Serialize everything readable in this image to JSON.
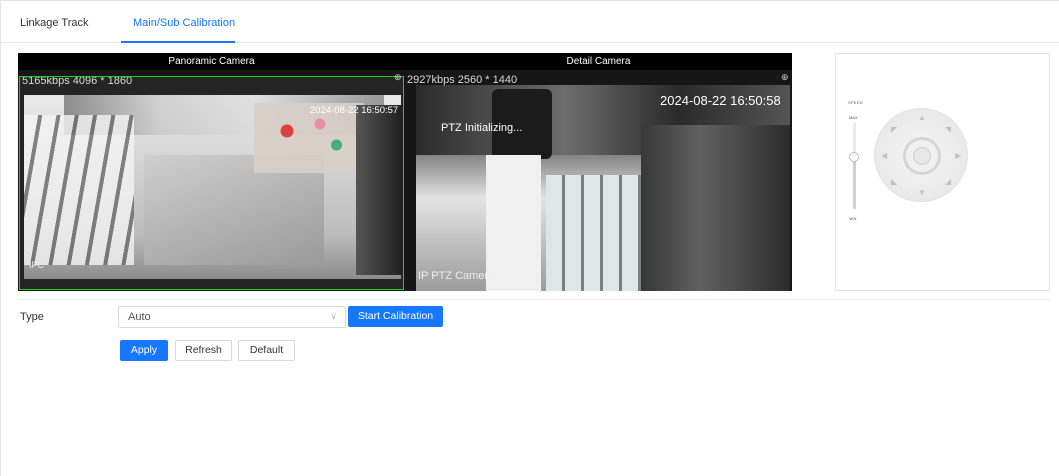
{
  "tabs": [
    {
      "label": "Linkage Track",
      "active": false
    },
    {
      "label": "Main/Sub Calibration",
      "active": true
    }
  ],
  "panoramic": {
    "title": "Panoramic Camera",
    "bitrate": "5165kbps",
    "resolution": "4096 * 1860",
    "timestamp": "2024-08-22 16:50:57",
    "channel_label": "IPC"
  },
  "detail": {
    "title": "Detail Camera",
    "bitrate": "2927kbps",
    "resolution": "2560 * 1440",
    "timestamp": "2024-08-22 16:50:58",
    "status_text": "PTZ Initializing...",
    "channel_label": "IP PTZ Camera"
  },
  "ptz": {
    "speed_label": "SPEED",
    "max_label": "MAX",
    "min_label": "MIN",
    "speed_level": 0.6
  },
  "form": {
    "type_label": "Type",
    "type_value": "Auto",
    "start_calibration": "Start Calibration",
    "apply": "Apply",
    "refresh": "Refresh",
    "default": "Default"
  },
  "colors": {
    "accent": "#1677ff",
    "pano_border": "#1fd11f"
  },
  "icons": {
    "zoom": "zoom-in-icon",
    "select_arrow": "chevron-down-icon",
    "joystick": "direction-pad-icon"
  }
}
